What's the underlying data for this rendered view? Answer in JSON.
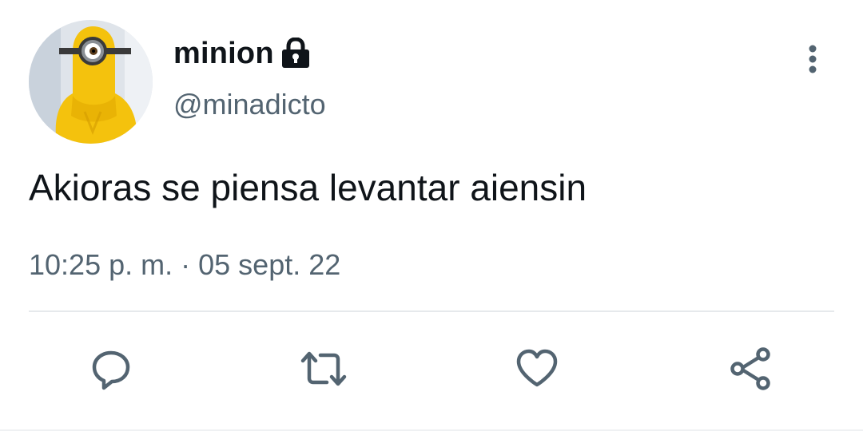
{
  "tweet": {
    "author": {
      "display_name": "minion",
      "handle": "@minadicto",
      "protected_icon": "lock-icon",
      "avatar": "minion-avatar"
    },
    "text": "Akioras se piensa levantar aiensin",
    "time": "10:25 p. m.",
    "separator": "·",
    "date": "05 sept. 22",
    "menu_icon": "more-vertical-icon",
    "actions": [
      {
        "name": "reply",
        "icon": "reply-icon"
      },
      {
        "name": "retweet",
        "icon": "retweet-icon"
      },
      {
        "name": "like",
        "icon": "heart-icon"
      },
      {
        "name": "share",
        "icon": "share-icon"
      }
    ]
  },
  "colors": {
    "text_primary": "#0f1419",
    "text_secondary": "#536471",
    "icon_gray": "#536471",
    "divider": "#e6e9ec",
    "avatar_yellow": "#f6c90e"
  }
}
